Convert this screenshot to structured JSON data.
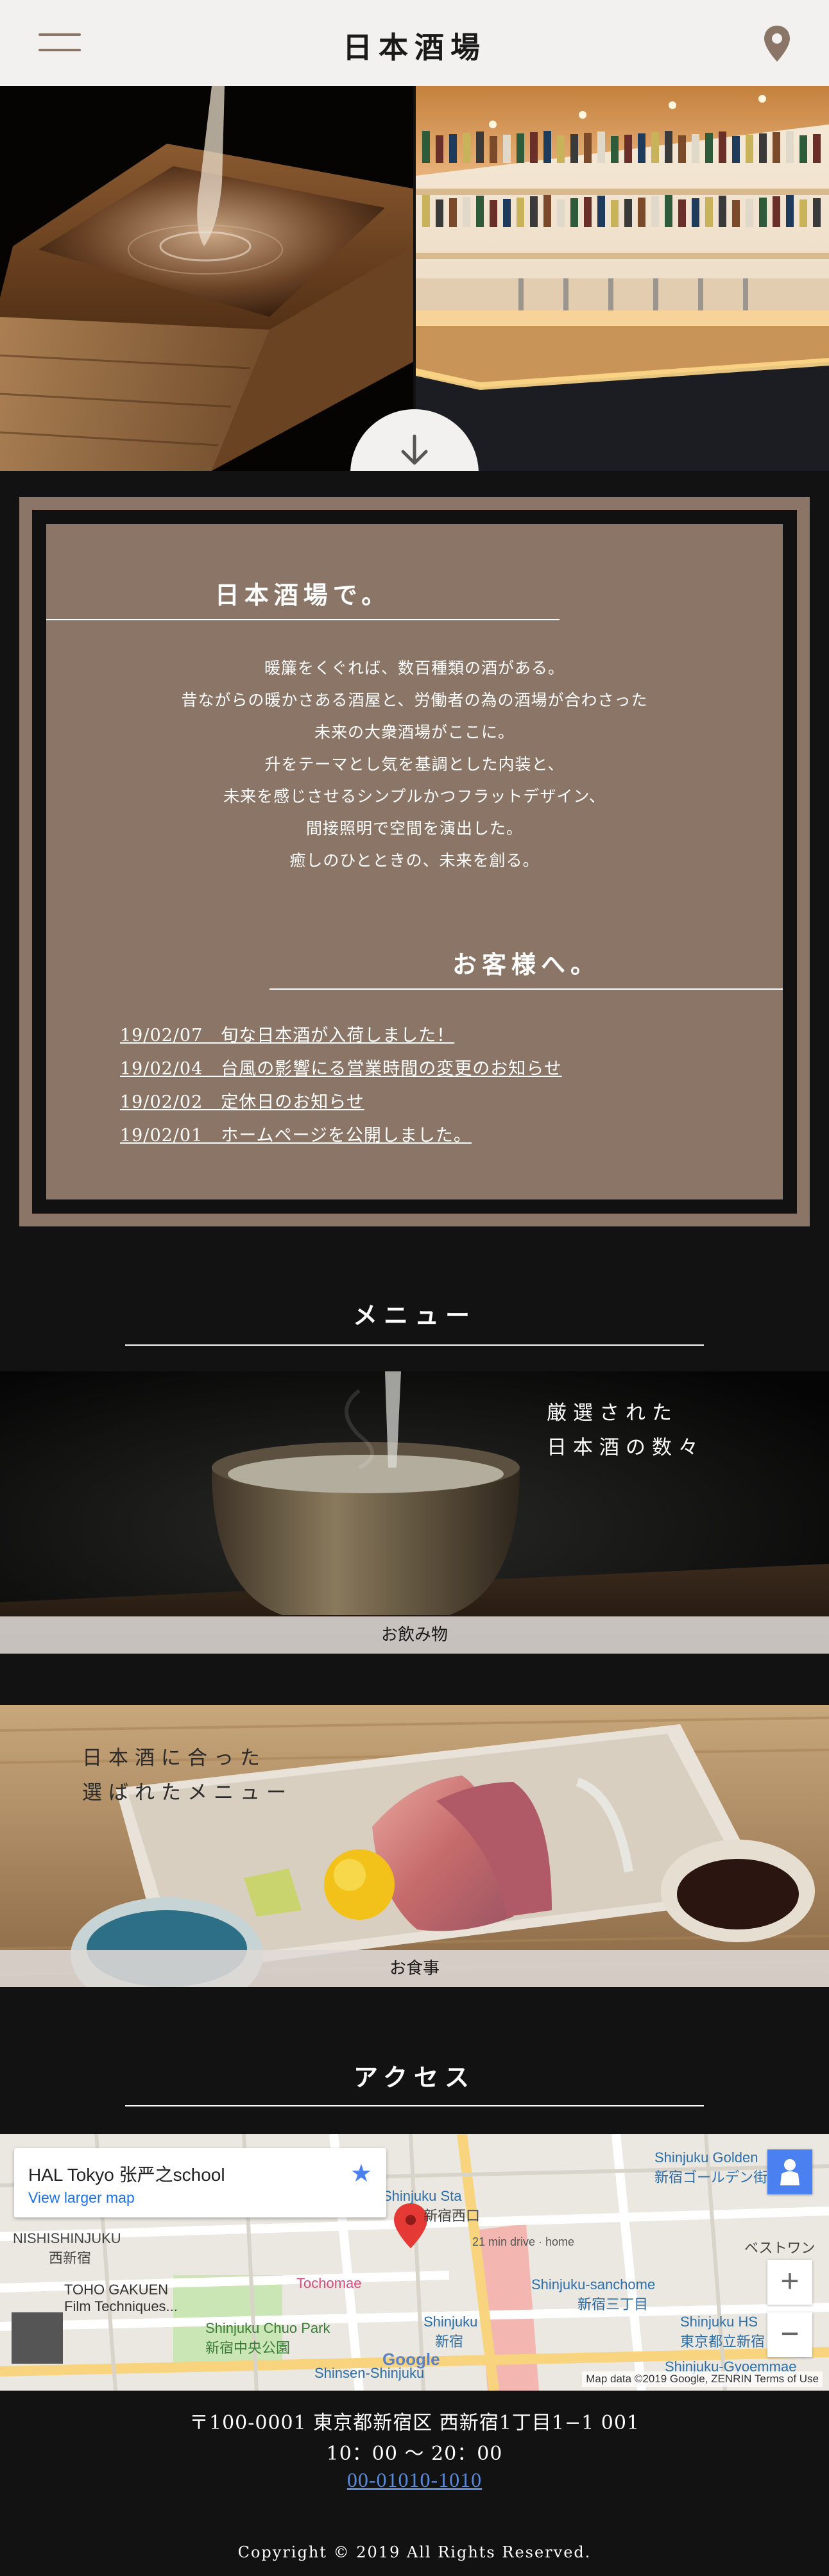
{
  "header": {
    "title": "日本酒場",
    "menu_icon": "hamburger-icon",
    "location_icon": "map-pin-icon"
  },
  "hero": {
    "scroll_icon": "arrow-down-icon"
  },
  "intro": {
    "heading": "日本酒場で。",
    "lines": [
      "暖簾をくぐれば、数百種類の酒がある。",
      "昔ながらの暖かさある酒屋と、労働者の為の酒場が合わさった",
      "未来の大衆酒場がここに。",
      "升をテーマとし気を基調とした内装と、",
      "未来を感じさせるシンプルかつフラットデザイン、",
      "間接照明で空間を演出した。",
      "癒しのひとときの、未来を創る。"
    ],
    "news_heading": "お客様へ。",
    "news": [
      "19/02/07　旬な日本酒が入荷しました！",
      "19/02/04　台風の影響にる営業時間の変更のお知らせ",
      "19/02/02　定休日のお知らせ",
      "19/02/01　ホームページを公開しました。"
    ]
  },
  "menu": {
    "heading": "メニュー",
    "drinks": {
      "copy_line1": "厳選された",
      "copy_line2": "日本酒の数々",
      "caption": "お飲み物"
    },
    "food": {
      "copy_line1": "日本酒に合った",
      "copy_line2": "選ばれたメニュー",
      "caption": "お食事"
    }
  },
  "access": {
    "heading": "アクセス",
    "map": {
      "place_name": "HAL Tokyo 张严之school",
      "larger_map": "View larger map",
      "star_icon": "star-icon",
      "labels": {
        "nishishinjuku": "NISHISHINJUKU",
        "nishishinjuku_jp": "西新宿",
        "tohogakuen": "TOHO GAKUEN",
        "film": "Film Techniques...",
        "tochomae": "Tochomae",
        "chuo_park": "Shinjuku Chuo Park",
        "chuo_park_jp": "新宿中央公園",
        "shinjuku_sta": "Shinjuku Sta",
        "drive": "21 min drive · home",
        "sanchome": "Shinjuku-sanchome",
        "sanchome_jp": "新宿三丁目",
        "golden": "Shinjuku Golden",
        "golden_jp": "新宿ゴールデン街",
        "bestwon": "ベストワン",
        "hs": "Shinjuku HS",
        "hs_jp": "東京都立新宿",
        "shinjuku": "Shinjuku",
        "shinjuku_jp": "新宿",
        "shinsen": "Shinsen-Shinjuku",
        "gyoen": "Shinjuku-Gyoemmae",
        "nishiguchi": "新宿西口",
        "google": "Google"
      },
      "zoom_in": "+",
      "zoom_out": "−",
      "attribution": "Map data ©2019 Google, ZENRIN   Terms of Use"
    },
    "address": "〒100-0001 東京都新宿区 西新宿1丁目1−1 001",
    "hours": "10：00 〜 20：00",
    "tel": "00-01010-1010"
  },
  "footer": {
    "copyright": "Copyright © 2019 All Rights Reserved."
  },
  "colors": {
    "brand": "#8a7566",
    "header_bg": "#f2f1ef",
    "page_bg": "#121212",
    "link": "#5c8bd6"
  }
}
